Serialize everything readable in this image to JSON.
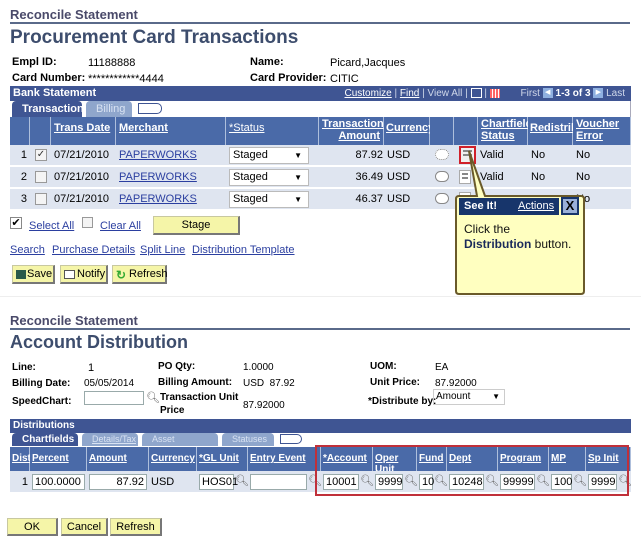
{
  "top": {
    "section_title": "Reconcile Statement",
    "page_title": "Procurement Card Transactions",
    "fields": {
      "empl_id_label": "Empl ID:",
      "empl_id_value": "11188888",
      "card_number_label": "Card Number:",
      "card_number_value": "************4444",
      "name_label": "Name:",
      "name_value": "Picard,Jacques",
      "card_provider_label": "Card Provider:",
      "card_provider_value": "CITIC"
    },
    "grid": {
      "title": "Bank Statement",
      "nav": {
        "customize": "Customize",
        "find": "Find",
        "view_all": "View All",
        "first": "First",
        "range": "1-3 of 3",
        "last": "Last",
        "sep": "|"
      },
      "tabs": [
        "Transaction",
        "Billing"
      ],
      "headers": [
        "Trans Date",
        "Merchant",
        "*Status",
        "Transaction Amount",
        "Currency",
        "Chartfield Status",
        "Redistrib",
        "Voucher Error"
      ],
      "rows": [
        {
          "num": "1",
          "checked": true,
          "date": "07/21/2010",
          "merchant": "PAPERWORKS",
          "status": "Staged",
          "amount": "87.92",
          "currency": "USD",
          "cf_status": "Valid",
          "redistrib": "No",
          "voucher_error": "No"
        },
        {
          "num": "2",
          "checked": false,
          "date": "07/21/2010",
          "merchant": "PAPERWORKS",
          "status": "Staged",
          "amount": "36.49",
          "currency": "USD",
          "cf_status": "Valid",
          "redistrib": "No",
          "voucher_error": "No"
        },
        {
          "num": "3",
          "checked": false,
          "date": "07/21/2010",
          "merchant": "PAPERWORKS",
          "status": "Staged",
          "amount": "46.37",
          "currency": "USD",
          "cf_status": "",
          "redistrib": "",
          "voucher_error": "No"
        }
      ]
    },
    "select_all": "Select All",
    "clear_all": "Clear All",
    "stage_button": "Stage",
    "links": [
      "Search",
      "Purchase Details",
      "Split Line",
      "Distribution Template"
    ],
    "toolbar": {
      "save": "Save",
      "notify": "Notify",
      "refresh": "Refresh"
    }
  },
  "tooltip": {
    "see_it": "See It!",
    "actions": "Actions",
    "close": "X",
    "text_pre": "Click the",
    "text_bold": "Distribution",
    "text_post": " button."
  },
  "bottom": {
    "section_title": "Reconcile Statement",
    "page_title": "Account Distribution",
    "fields": {
      "line_label": "Line:",
      "line_value": "1",
      "po_qty_label": "PO Qty:",
      "po_qty_value": "1.0000",
      "uom_label": "UOM:",
      "uom_value": "EA",
      "billing_date_label": "Billing Date:",
      "billing_date_value": "05/05/2014",
      "billing_amount_label": "Billing Amount:",
      "billing_amount_value": "USD  87.92",
      "unit_price_label": "Unit Price:",
      "unit_price_value": "87.92000",
      "speedchart_label": "SpeedChart:",
      "speedchart_value": "",
      "tx_unit_price_label": "Transaction Unit Price",
      "tx_unit_price_value": "87.92000",
      "distribute_by_label": "*Distribute by:",
      "distribute_by_value": "Amount"
    },
    "grid": {
      "title": "Distributions",
      "tabs": [
        "Chartfields",
        "Details/Tax",
        "Asset Information",
        "Statuses"
      ],
      "headers": [
        "Dist",
        "Percent",
        "Amount",
        "Currency",
        "*GL Unit",
        "Entry Event",
        "*Account",
        "Oper Unit",
        "Fund",
        "Dept",
        "Program",
        "MP",
        "Sp Init"
      ],
      "row": {
        "dist": "1",
        "percent": "100.0000",
        "amount": "87.92",
        "currency": "USD",
        "gl_unit": "HOS01",
        "entry_event": "",
        "account": "10001",
        "oper_unit": "9999",
        "fund": "10",
        "dept": "10248",
        "program": "99999",
        "mp": "100",
        "sp_init": "9999"
      }
    },
    "buttons": {
      "ok": "OK",
      "cancel": "Cancel",
      "refresh": "Refresh"
    }
  },
  "colors": {
    "header_bar": "#3f5593",
    "grid_header": "#4a6aa8",
    "button_bg": "#f5f5a8",
    "highlight": "#d0202a",
    "tooltip_bg": "#ffffc0"
  }
}
